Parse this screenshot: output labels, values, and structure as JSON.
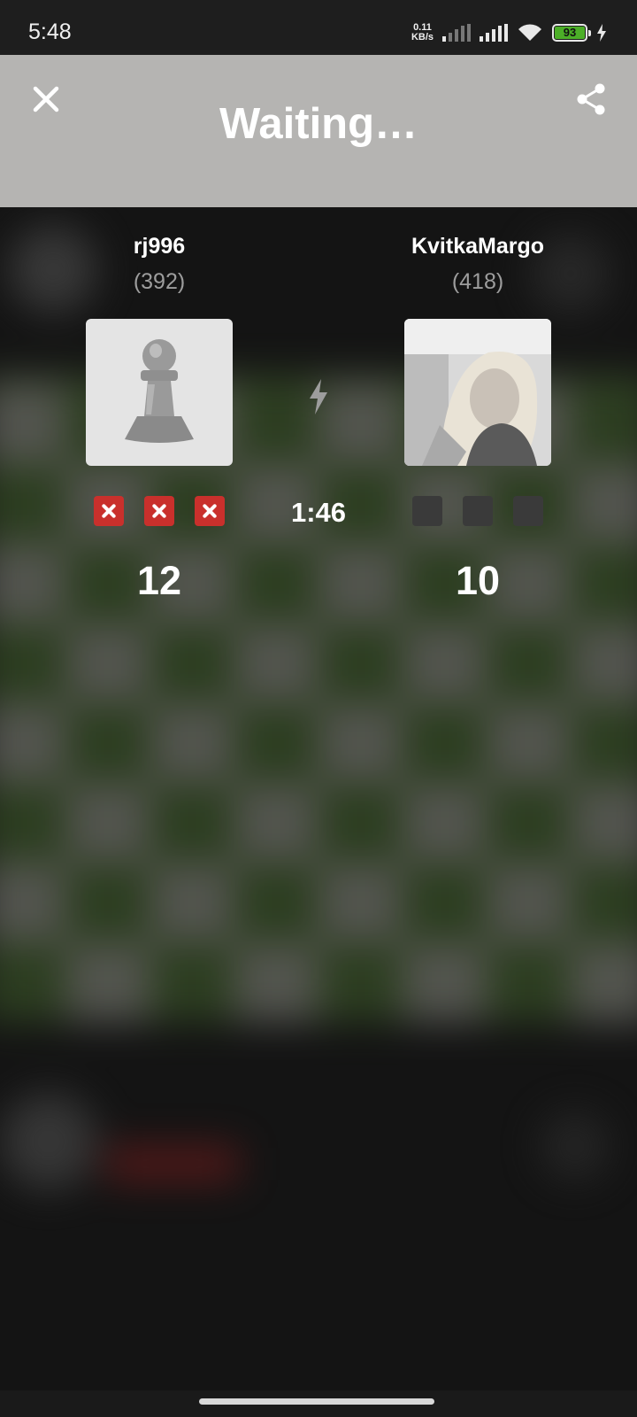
{
  "status_bar": {
    "time": "5:48",
    "net_speed_value": "0.11",
    "net_speed_unit": "KB/s",
    "battery_level": "93"
  },
  "header": {
    "title": "Waiting…"
  },
  "players": {
    "left": {
      "name": "rj996",
      "rating": "(392)",
      "score": "12",
      "avatar": "pawn-placeholder-icon",
      "results": [
        "loss",
        "loss",
        "loss"
      ]
    },
    "right": {
      "name": "KvitkaMargo",
      "rating": "(418)",
      "score": "10",
      "avatar": "profile-photo",
      "results": [
        "pending",
        "pending",
        "pending"
      ]
    }
  },
  "match": {
    "mode_icon": "lightning-bolt-icon",
    "clock": "1:46"
  },
  "colors": {
    "header_bg": "#b5b4b2",
    "loss_mark": "#c9302c",
    "pending_mark": "#3a3a3a",
    "battery_fill": "#4caf28"
  }
}
